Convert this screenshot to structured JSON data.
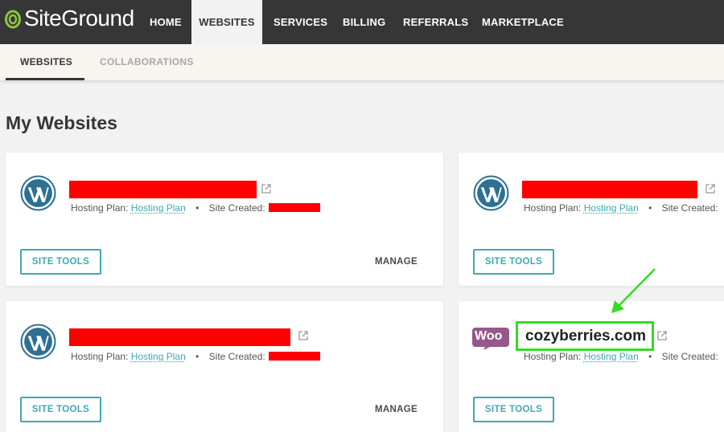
{
  "brand": {
    "name": "SiteGround",
    "accent": "#3fa8b4",
    "nav_bg": "#363636",
    "highlight": "#33dd22"
  },
  "nav": {
    "items": [
      {
        "label": "HOME"
      },
      {
        "label": "WEBSITES",
        "active": true
      },
      {
        "label": "SERVICES"
      },
      {
        "label": "BILLING"
      },
      {
        "label": "REFERRALS"
      },
      {
        "label": "MARKETPLACE"
      }
    ]
  },
  "subnav": {
    "items": [
      {
        "label": "WEBSITES",
        "active": true
      },
      {
        "label": "COLLABORATIONS"
      }
    ]
  },
  "page_title": "My Websites",
  "sites": [
    {
      "icon": "wordpress-icon",
      "plan_label": "Hosting Plan:",
      "plan_value": "Hosting Plan",
      "created_label": "Site Created:",
      "tools_label": "SITE TOOLS",
      "manage_label": "MANAGE"
    },
    {
      "icon": "wordpress-icon",
      "plan_label": "Hosting Plan:",
      "plan_value": "Hosting Plan",
      "created_label": "Site Created:",
      "tools_label": "SITE TOOLS"
    },
    {
      "icon": "wordpress-icon",
      "plan_label": "Hosting Plan:",
      "plan_value": "Hosting Plan",
      "created_label": "Site Created:",
      "tools_label": "SITE TOOLS",
      "manage_label": "MANAGE"
    },
    {
      "icon": "woocommerce-icon",
      "icon_text": "Woo",
      "name": "cozyberries.com",
      "plan_label": "Hosting Plan:",
      "plan_value": "Hosting Plan",
      "created_label": "Site Created:",
      "tools_label": "SITE TOOLS"
    }
  ]
}
